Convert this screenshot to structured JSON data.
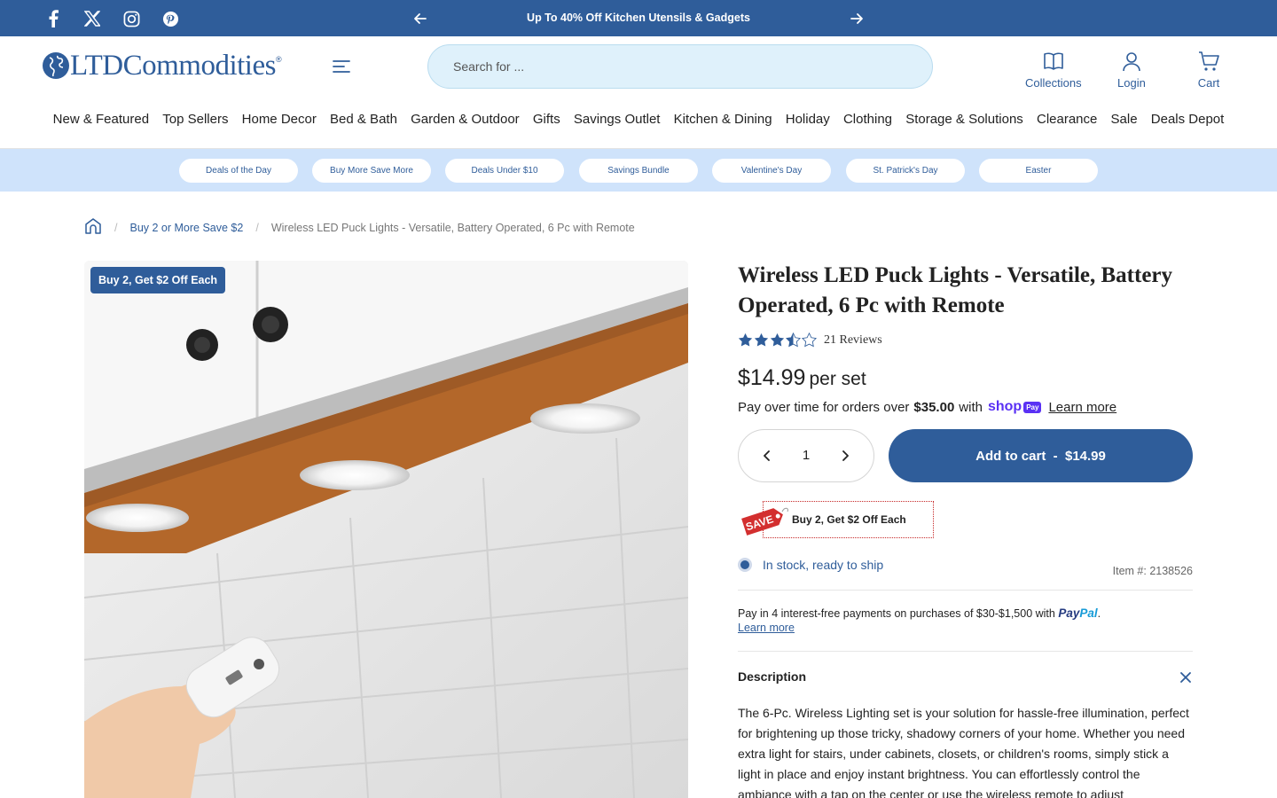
{
  "announcement": {
    "text": "Up To 40% Off Kitchen Utensils & Gadgets",
    "social_icons": [
      "facebook-icon",
      "x-icon",
      "instagram-icon",
      "pinterest-icon"
    ]
  },
  "header": {
    "logo_text": "LTDCommodities",
    "logo_mark": "®",
    "search_placeholder": "Search for ...",
    "links": {
      "collections": "Collections",
      "login": "Login",
      "cart": "Cart"
    }
  },
  "nav": {
    "items": [
      "New & Featured",
      "Top Sellers",
      "Home Decor",
      "Bed & Bath",
      "Garden & Outdoor",
      "Gifts",
      "Savings Outlet",
      "Kitchen & Dining",
      "Holiday",
      "Clothing",
      "Storage & Solutions",
      "Clearance",
      "Sale",
      "Deals Depot"
    ]
  },
  "pills": [
    "Deals of the Day",
    "Buy More Save More",
    "Deals Under $10",
    "Savings Bundle",
    "Valentine's Day",
    "St. Patrick's Day",
    "Easter"
  ],
  "breadcrumb": {
    "category": "Buy 2 or More Save $2",
    "current": "Wireless LED Puck Lights - Versatile, Battery Operated, 6 Pc with Remote"
  },
  "product": {
    "badge": "Buy 2, Get $2 Off Each",
    "title": "Wireless LED Puck Lights - Versatile, Battery Operated, 6 Pc with Remote",
    "rating": 3.5,
    "rating_max": 5,
    "reviews": "21 Reviews",
    "price": "$14.99",
    "price_unit": "per set",
    "shoppay": {
      "prefix": "Pay over time for orders over",
      "amount": "$35.00",
      "suffix": "with",
      "brand": "shop",
      "brand_badge": "Pay",
      "learn_more": "Learn more"
    },
    "quantity": "1",
    "add_to_cart": "Add to cart  -  $14.99",
    "promo_tag": "SAVE",
    "promo_label": "Buy 2, Get $2 Off Each",
    "stock": "In stock, ready to ship",
    "item_number": "Item #: 2138526",
    "paypal": {
      "text": "Pay in 4 interest-free payments on purchases of $30-$1,500 with",
      "brand_a": "Pay",
      "brand_b": "Pal",
      "end": ".",
      "learn_more": "Learn more"
    },
    "description_heading": "Description",
    "description": "The 6-Pc. Wireless Lighting set is your solution for hassle-free illumination, perfect for brightening up those tricky, shadowy corners of your home. Whether you need extra light for stairs, under cabinets, closets, or children's rooms, simply stick a light in place and enjoy instant brightness. You can effortlessly control the ambiance with a tap on the center or use the wireless remote to adjust"
  },
  "colors": {
    "brand_blue": "#2f5d9a",
    "pill_bar": "#cfe3fb",
    "search_bg": "#dff1fb",
    "star": "#2f5d9a"
  }
}
